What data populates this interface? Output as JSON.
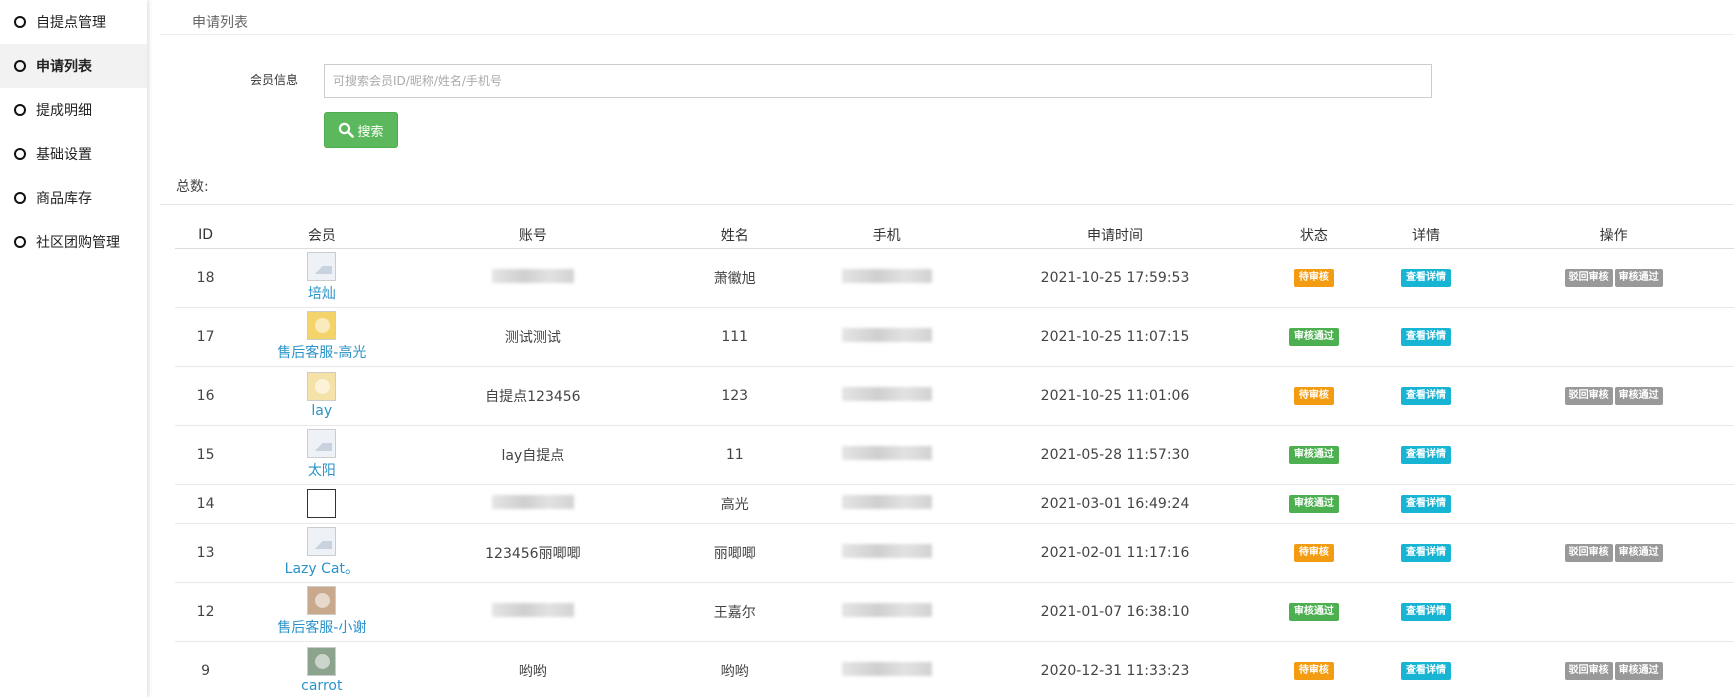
{
  "sidebar": {
    "items": [
      {
        "label": "自提点管理",
        "active": false
      },
      {
        "label": "申请列表",
        "active": true
      },
      {
        "label": "提成明细",
        "active": false
      },
      {
        "label": "基础设置",
        "active": false
      },
      {
        "label": "商品库存",
        "active": false
      },
      {
        "label": "社区团购管理",
        "active": false
      }
    ]
  },
  "page": {
    "title": "申请列表",
    "filter_label": "会员信息",
    "search_placeholder": "可搜索会员ID/昵称/姓名/手机号",
    "search_button": "搜索",
    "total_label": "总数:"
  },
  "table": {
    "headers": [
      "ID",
      "会员",
      "账号",
      "姓名",
      "手机",
      "申请时间",
      "状态",
      "详情",
      "操作"
    ],
    "detail_label": "查看详情",
    "reject_label": "驳回审核",
    "approve_label": "审核通过",
    "rows": [
      {
        "id": "18",
        "member": "培灿",
        "account": "",
        "name": "萧徽旭",
        "time": "2021-10-25 17:59:53",
        "status": "待审核"
      },
      {
        "id": "17",
        "member": "售后客服-高光",
        "account": "测试测试",
        "name": "111",
        "time": "2021-10-25 11:07:15",
        "status": "审核通过"
      },
      {
        "id": "16",
        "member": "lay",
        "account": "自提点123456",
        "name": "123",
        "time": "2021-10-25 11:01:06",
        "status": "待审核"
      },
      {
        "id": "15",
        "member": "太阳",
        "account": "lay自提点",
        "name": "11",
        "time": "2021-05-28 11:57:30",
        "status": "审核通过"
      },
      {
        "id": "14",
        "member": "",
        "account": "",
        "name": "高光",
        "time": "2021-03-01 16:49:24",
        "status": "审核通过"
      },
      {
        "id": "13",
        "member": "Lazy Cat。",
        "account": "123456丽唧唧",
        "name": "丽唧唧",
        "time": "2021-02-01 11:17:16",
        "status": "待审核"
      },
      {
        "id": "12",
        "member": "售后客服-小谢",
        "account": "",
        "name": "王嘉尔",
        "time": "2021-01-07 16:38:10",
        "status": "审核通过"
      },
      {
        "id": "9",
        "member": "carrot",
        "account": "哟哟",
        "name": "哟哟",
        "time": "2020-12-31 11:33:23",
        "status": "待审核"
      }
    ]
  },
  "colors": {
    "pending": "#f39c12",
    "passed": "#4caf50",
    "detail": "#17b4d3",
    "ops": "#999999",
    "search_button": "#5cb85c",
    "member_link": "#2a93c9"
  }
}
